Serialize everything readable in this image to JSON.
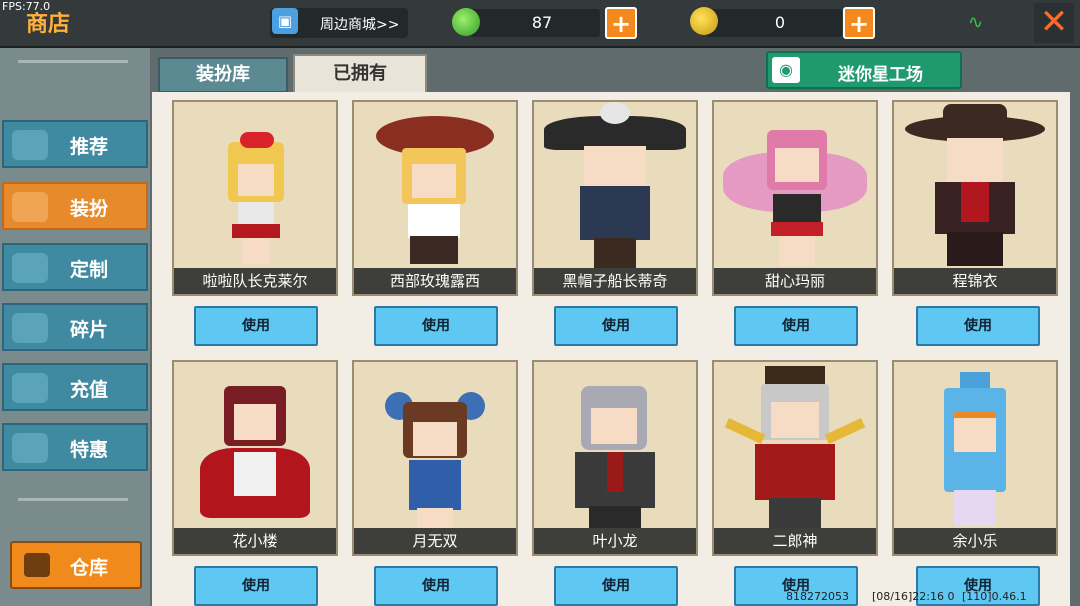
{
  "fps": "FPS:77.0",
  "shop_title": "商店",
  "mall_link": "周边商城>>",
  "currency": {
    "gems": "87",
    "coins": "0",
    "plus": "+"
  },
  "close_symbol": "✕",
  "sidebar": {
    "items": [
      {
        "label": "推荐",
        "icon": "thumbs-up-icon"
      },
      {
        "label": "装扮",
        "icon": "shirt-icon"
      },
      {
        "label": "定制",
        "icon": "pencil-icon"
      },
      {
        "label": "碎片",
        "icon": "puzzle-icon"
      },
      {
        "label": "充值",
        "icon": "coins-icon"
      },
      {
        "label": "特惠",
        "icon": "gift-icon"
      }
    ],
    "active": "装扮",
    "warehouse": "仓库"
  },
  "tabs": [
    "装扮库",
    "已拥有"
  ],
  "active_tab": "已拥有",
  "workshop_button": "迷你星工场",
  "use_label": "使用",
  "skins_row1": [
    "啦啦队长克莱尔",
    "西部玫瑰露西",
    "黑帽子船长蒂奇",
    "甜心玛丽",
    "程锦衣"
  ],
  "skins_row2": [
    "花小楼",
    "月无双",
    "叶小龙",
    "二郎神",
    "余小乐"
  ],
  "footer": {
    "id": "818272053",
    "time": "[08/16]22:16 0",
    "coords": "[110]0.46.1"
  },
  "colors": {
    "accent_orange": "#f08a1a",
    "use_blue": "#5ec8f2",
    "sidebar_teal": "#3f8aa0",
    "workshop_green": "#1f9a6e"
  }
}
